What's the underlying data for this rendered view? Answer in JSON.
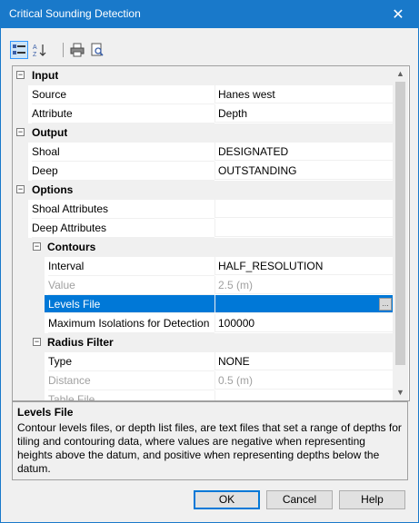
{
  "window": {
    "title": "Critical Sounding Detection",
    "close_symbol": "✕"
  },
  "toolbar": {
    "buttons": [
      "categorized-view",
      "alphabetical-sort",
      "print",
      "print-preview"
    ],
    "sort_label": "A↓Z"
  },
  "grid": {
    "sections": {
      "input": "Input",
      "output": "Output",
      "options": "Options",
      "contours": "Contours",
      "radius_filter": "Radius Filter"
    },
    "toggle_symbol": "−",
    "rows": {
      "source": {
        "name": "Source",
        "value": "Hanes west"
      },
      "attribute": {
        "name": "Attribute",
        "value": "Depth"
      },
      "shoal": {
        "name": "Shoal",
        "value": "DESIGNATED"
      },
      "deep": {
        "name": "Deep",
        "value": "OUTSTANDING"
      },
      "shoal_attributes": {
        "name": "Shoal Attributes",
        "value": ""
      },
      "deep_attributes": {
        "name": "Deep Attributes",
        "value": ""
      },
      "interval": {
        "name": "Interval",
        "value": "HALF_RESOLUTION"
      },
      "value": {
        "name": "Value",
        "value": "2.5 (m)"
      },
      "levels_file": {
        "name": "Levels File",
        "value": "",
        "button": "..."
      },
      "max_isolations": {
        "name": "Maximum Isolations for Detection",
        "value": "100000"
      },
      "type": {
        "name": "Type",
        "value": "NONE"
      },
      "distance": {
        "name": "Distance",
        "value": "0.5 (m)"
      },
      "table_file": {
        "name": "Table File",
        "value": ""
      }
    }
  },
  "help": {
    "title": "Levels File",
    "text": "Contour levels files, or depth list files, are text files that set a range of depths for tiling and contouring data, where values are negative when representing heights above the datum, and positive when representing depths below the datum."
  },
  "buttons": {
    "ok": "OK",
    "cancel": "Cancel",
    "help": "Help"
  },
  "colors": {
    "titlebar": "#1979ca",
    "selection": "#0078d7"
  }
}
